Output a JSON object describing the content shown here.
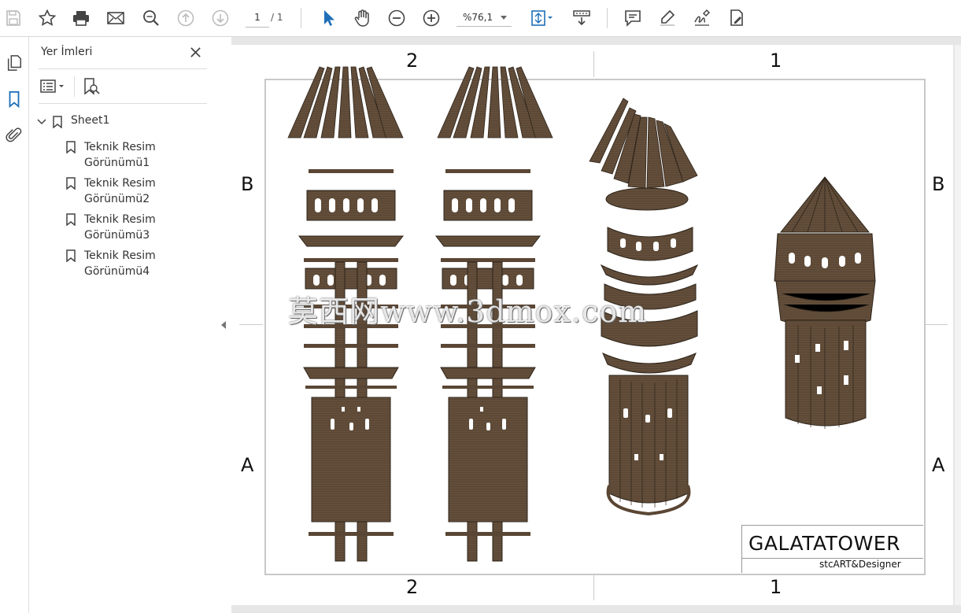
{
  "toolbar": {
    "page_current": "1",
    "page_total": "/ 1",
    "zoom": "%76,1",
    "icons": [
      "save-icon",
      "bookmark-star-icon",
      "print-icon",
      "email-icon",
      "find-icon",
      "page-up-icon",
      "page-down-icon",
      "select-cursor-icon",
      "hand-icon",
      "zoom-out-icon",
      "zoom-in-icon",
      "fit-page-icon",
      "scroll-mode-icon",
      "comment-icon",
      "highlight-icon",
      "sign-icon",
      "fill-sign-icon"
    ]
  },
  "left_rail": {
    "icons": [
      "pages-icon",
      "bookmarks-icon",
      "attachments-icon"
    ]
  },
  "bookmarks_panel": {
    "title": "Yer İmleri",
    "root": "Sheet1",
    "items": [
      {
        "line1": "Teknik Resim",
        "line2": "Görünümü1"
      },
      {
        "line1": "Teknik Resim",
        "line2": "Görünümü2"
      },
      {
        "line1": "Teknik Resim",
        "line2": "Görünümü3"
      },
      {
        "line1": "Teknik Resim",
        "line2": "Görünümü4"
      }
    ]
  },
  "drawing": {
    "zones_top": [
      "2",
      "1"
    ],
    "zones_bottom": [
      "2",
      "1"
    ],
    "zones_left": [
      "B",
      "A"
    ],
    "zones_right": [
      "B",
      "A"
    ],
    "title_block": {
      "name": "GALATATOWER",
      "author": "stcART&Designer"
    },
    "watermark": "莫西网www.3dmox.com",
    "colors": {
      "wood_dark": "#4a3a2a",
      "wood_mid": "#6b5843",
      "wood_light": "#8a7560"
    }
  }
}
